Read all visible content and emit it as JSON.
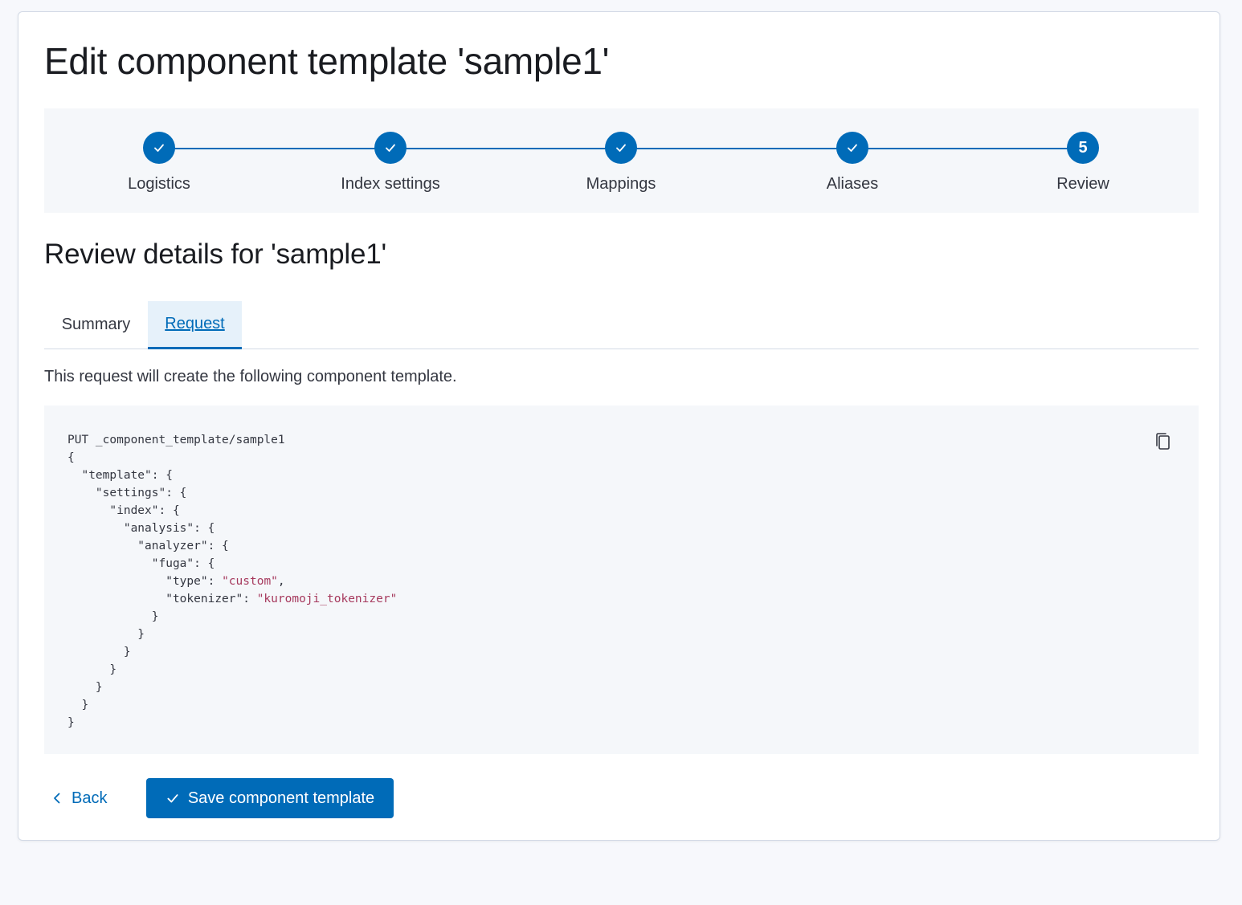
{
  "page": {
    "title": "Edit component template 'sample1'"
  },
  "steps": [
    {
      "label": "Logistics",
      "status": "complete",
      "icon": "check-icon"
    },
    {
      "label": "Index settings",
      "status": "complete",
      "icon": "check-icon"
    },
    {
      "label": "Mappings",
      "status": "complete",
      "icon": "check-icon"
    },
    {
      "label": "Aliases",
      "status": "complete",
      "icon": "check-icon"
    },
    {
      "label": "Review",
      "status": "current",
      "number": "5"
    }
  ],
  "review": {
    "title": "Review details for 'sample1'",
    "tabs": [
      {
        "label": "Summary",
        "selected": false
      },
      {
        "label": "Request",
        "selected": true
      }
    ],
    "description": "This request will create the following component template."
  },
  "request": {
    "method": "PUT",
    "path": "_component_template/sample1",
    "body": {
      "template": {
        "settings": {
          "index": {
            "analysis": {
              "analyzer": {
                "fuga": {
                  "type": "custom",
                  "tokenizer": "kuromoji_tokenizer"
                }
              }
            }
          }
        }
      }
    }
  },
  "actions": {
    "back_label": "Back",
    "save_label": "Save component template"
  },
  "colors": {
    "primary": "#006bb8",
    "code_string": "#a6395d",
    "panel_bg": "#f5f7fa"
  }
}
